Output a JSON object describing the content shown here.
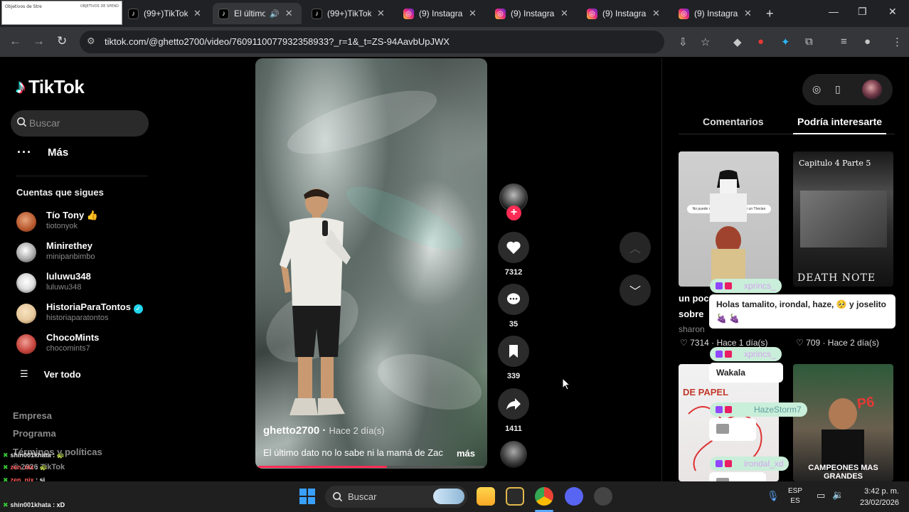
{
  "browser": {
    "thumbnail": {
      "left_text": "Objetivos de Stre",
      "right_text": "OBJETIVOS DE SPEND"
    },
    "tabs": [
      {
        "label": "(99+)TikTok",
        "icon": "tiktok-icon"
      },
      {
        "label": "El último",
        "icon": "tiktok-icon",
        "active": true,
        "audio": true
      },
      {
        "label": "(99+)TikTok",
        "icon": "tiktok-icon"
      },
      {
        "label": "(9) Instagram",
        "icon": "instagram-icon"
      },
      {
        "label": "(9) Instagram",
        "icon": "instagram-icon"
      },
      {
        "label": "(9) Instagram",
        "icon": "instagram-icon"
      },
      {
        "label": "(9) Instagram",
        "icon": "instagram-icon"
      }
    ],
    "url": "tiktok.com/@ghetto2700/video/7609110077932358933?_r=1&_t=ZS-94AavbUpJWX"
  },
  "sidebar": {
    "logo": "TikTok",
    "search_placeholder": "Buscar",
    "more_label": "Más",
    "following_title": "Cuentas que sigues",
    "accounts": [
      {
        "name": "Tío Tony 👍",
        "user": "tiotonyok",
        "color": "#b5562c"
      },
      {
        "name": "Minirethey",
        "user": "minipanbimbo",
        "color": "#cfcfcf"
      },
      {
        "name": "luluwu348",
        "user": "luluwu348",
        "color": "#e8e8e8"
      },
      {
        "name": "HistoriaParaTontos",
        "user": "historiaparatontos",
        "color": "#e6c79c",
        "verified": true
      },
      {
        "name": "ChocoMints",
        "user": "chocomints7",
        "color": "#c7463e"
      }
    ],
    "see_all": "Ver todo",
    "footer": [
      "Empresa",
      "Programa",
      "Términos y políticas",
      "© 2026 TikTok"
    ]
  },
  "video": {
    "username": "ghetto2700",
    "ago": "Hace 2 día(s)",
    "description": "El último dato no lo sabe ni la mamá de Zac",
    "more": "más",
    "progress": 0.57,
    "likes": "7312",
    "comments": "35",
    "saves": "339",
    "shares": "1411"
  },
  "right_panel": {
    "tabs": [
      "Comentarios",
      "Podría interesarte"
    ],
    "cards": [
      {
        "title": "un poc",
        "sub": "sobre",
        "author": "sharon",
        "stats": "7314 · Hace 1 día(s)",
        "inset": "No puede ser me acaba de morder un Therian"
      },
      {
        "title": "",
        "stats": "709 · Hace 2 día(s)",
        "overlay": "DEATH NOTE",
        "overlay2": "Capitulo 4 Parte 5"
      },
      {
        "overlay": "DE PAPEL"
      },
      {
        "overlay": "CAMPEONES MAS GRANDES"
      }
    ]
  },
  "chat": [
    {
      "user": "xprincs_",
      "text": "Holas tamalito, irondal, haze, 🥺 y joselito 🍇 🍇"
    },
    {
      "user": "xprincs_",
      "text": "Wakala"
    },
    {
      "user": "HazeStorm7",
      "text": ""
    },
    {
      "user": "irondal_xd",
      "text": ""
    }
  ],
  "stream_chat": [
    {
      "user": "shin001khata",
      "text": "🐢",
      "color": "#e8e8e8"
    },
    {
      "user": "zen_nix",
      "text": "🐢",
      "color": "#ff5a5a"
    },
    {
      "user": "zen_nix",
      "text": "si",
      "color": "#ff5a5a"
    },
    {
      "user": "zen_nix",
      "text": "🐢",
      "color": "#ff5a5a"
    },
    {
      "user": "shin001khata",
      "text": "xD",
      "color": "#e8e8e8"
    }
  ],
  "taskbar": {
    "search_placeholder": "Buscar",
    "lang": "ESP",
    "lang2": "ES",
    "time": "3:42 p. m.",
    "date": "23/02/2026"
  }
}
